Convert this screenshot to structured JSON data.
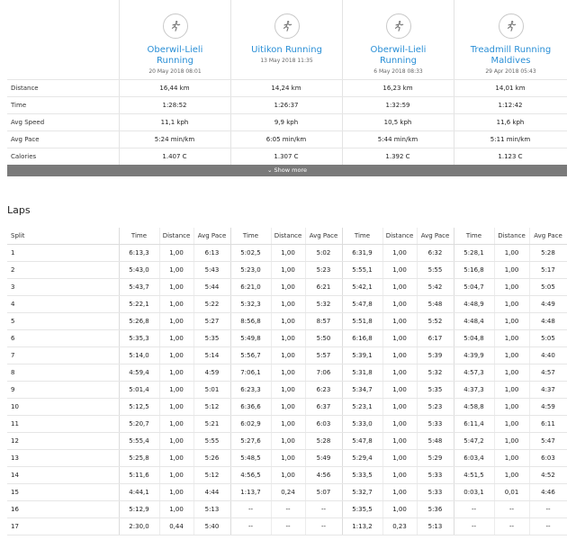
{
  "activities": [
    {
      "title": "Oberwil-Lieli Running",
      "date": "20 May 2018 08:01",
      "icon": "runner-icon"
    },
    {
      "title": "Uitikon Running",
      "date": "13 May 2018 11:35",
      "icon": "runner-icon"
    },
    {
      "title": "Oberwil-Lieli Running",
      "date": "6 May 2018 08:33",
      "icon": "runner-icon"
    },
    {
      "title": "Treadmill Running Maldives",
      "date": "29 Apr 2018 05:43",
      "icon": "runner-icon"
    }
  ],
  "stats": [
    {
      "label": "Distance",
      "values": [
        "16,44 km",
        "14,24 km",
        "16,23 km",
        "14,01 km"
      ]
    },
    {
      "label": "Time",
      "values": [
        "1:28:52",
        "1:26:37",
        "1:32:59",
        "1:12:42"
      ]
    },
    {
      "label": "Avg Speed",
      "values": [
        "11,1 kph",
        "9,9 kph",
        "10,5 kph",
        "11,6 kph"
      ]
    },
    {
      "label": "Avg Pace",
      "values": [
        "5:24 min/km",
        "6:05 min/km",
        "5:44 min/km",
        "5:11 min/km"
      ]
    },
    {
      "label": "Calories",
      "values": [
        "1.407 C",
        "1.307 C",
        "1.392 C",
        "1.123 C"
      ]
    }
  ],
  "show_more_label": "Show more",
  "laps": {
    "title": "Laps",
    "split_header": "Split",
    "col_headers": [
      "Time",
      "Distance",
      "Avg Pace"
    ],
    "rows": [
      {
        "split": "1",
        "cells": [
          [
            "6:13,3",
            "1,00",
            "6:13"
          ],
          [
            "5:02,5",
            "1,00",
            "5:02"
          ],
          [
            "6:31,9",
            "1,00",
            "6:32"
          ],
          [
            "5:28,1",
            "1,00",
            "5:28"
          ]
        ]
      },
      {
        "split": "2",
        "cells": [
          [
            "5:43,0",
            "1,00",
            "5:43"
          ],
          [
            "5:23,0",
            "1,00",
            "5:23"
          ],
          [
            "5:55,1",
            "1,00",
            "5:55"
          ],
          [
            "5:16,8",
            "1,00",
            "5:17"
          ]
        ]
      },
      {
        "split": "3",
        "cells": [
          [
            "5:43,7",
            "1,00",
            "5:44"
          ],
          [
            "6:21,0",
            "1,00",
            "6:21"
          ],
          [
            "5:42,1",
            "1,00",
            "5:42"
          ],
          [
            "5:04,7",
            "1,00",
            "5:05"
          ]
        ]
      },
      {
        "split": "4",
        "cells": [
          [
            "5:22,1",
            "1,00",
            "5:22"
          ],
          [
            "5:32,3",
            "1,00",
            "5:32"
          ],
          [
            "5:47,8",
            "1,00",
            "5:48"
          ],
          [
            "4:48,9",
            "1,00",
            "4:49"
          ]
        ]
      },
      {
        "split": "5",
        "cells": [
          [
            "5:26,8",
            "1,00",
            "5:27"
          ],
          [
            "8:56,8",
            "1,00",
            "8:57"
          ],
          [
            "5:51,8",
            "1,00",
            "5:52"
          ],
          [
            "4:48,4",
            "1,00",
            "4:48"
          ]
        ]
      },
      {
        "split": "6",
        "cells": [
          [
            "5:35,3",
            "1,00",
            "5:35"
          ],
          [
            "5:49,8",
            "1,00",
            "5:50"
          ],
          [
            "6:16,8",
            "1,00",
            "6:17"
          ],
          [
            "5:04,8",
            "1,00",
            "5:05"
          ]
        ]
      },
      {
        "split": "7",
        "cells": [
          [
            "5:14,0",
            "1,00",
            "5:14"
          ],
          [
            "5:56,7",
            "1,00",
            "5:57"
          ],
          [
            "5:39,1",
            "1,00",
            "5:39"
          ],
          [
            "4:39,9",
            "1,00",
            "4:40"
          ]
        ]
      },
      {
        "split": "8",
        "cells": [
          [
            "4:59,4",
            "1,00",
            "4:59"
          ],
          [
            "7:06,1",
            "1,00",
            "7:06"
          ],
          [
            "5:31,8",
            "1,00",
            "5:32"
          ],
          [
            "4:57,3",
            "1,00",
            "4:57"
          ]
        ]
      },
      {
        "split": "9",
        "cells": [
          [
            "5:01,4",
            "1,00",
            "5:01"
          ],
          [
            "6:23,3",
            "1,00",
            "6:23"
          ],
          [
            "5:34,7",
            "1,00",
            "5:35"
          ],
          [
            "4:37,3",
            "1,00",
            "4:37"
          ]
        ]
      },
      {
        "split": "10",
        "cells": [
          [
            "5:12,5",
            "1,00",
            "5:12"
          ],
          [
            "6:36,6",
            "1,00",
            "6:37"
          ],
          [
            "5:23,1",
            "1,00",
            "5:23"
          ],
          [
            "4:58,8",
            "1,00",
            "4:59"
          ]
        ]
      },
      {
        "split": "11",
        "cells": [
          [
            "5:20,7",
            "1,00",
            "5:21"
          ],
          [
            "6:02,9",
            "1,00",
            "6:03"
          ],
          [
            "5:33,0",
            "1,00",
            "5:33"
          ],
          [
            "6:11,4",
            "1,00",
            "6:11"
          ]
        ]
      },
      {
        "split": "12",
        "cells": [
          [
            "5:55,4",
            "1,00",
            "5:55"
          ],
          [
            "5:27,6",
            "1,00",
            "5:28"
          ],
          [
            "5:47,8",
            "1,00",
            "5:48"
          ],
          [
            "5:47,2",
            "1,00",
            "5:47"
          ]
        ]
      },
      {
        "split": "13",
        "cells": [
          [
            "5:25,8",
            "1,00",
            "5:26"
          ],
          [
            "5:48,5",
            "1,00",
            "5:49"
          ],
          [
            "5:29,4",
            "1,00",
            "5:29"
          ],
          [
            "6:03,4",
            "1,00",
            "6:03"
          ]
        ]
      },
      {
        "split": "14",
        "cells": [
          [
            "5:11,6",
            "1,00",
            "5:12"
          ],
          [
            "4:56,5",
            "1,00",
            "4:56"
          ],
          [
            "5:33,5",
            "1,00",
            "5:33"
          ],
          [
            "4:51,5",
            "1,00",
            "4:52"
          ]
        ]
      },
      {
        "split": "15",
        "cells": [
          [
            "4:44,1",
            "1,00",
            "4:44"
          ],
          [
            "1:13,7",
            "0,24",
            "5:07"
          ],
          [
            "5:32,7",
            "1,00",
            "5:33"
          ],
          [
            "0:03,1",
            "0,01",
            "4:46"
          ]
        ]
      },
      {
        "split": "16",
        "cells": [
          [
            "5:12,9",
            "1,00",
            "5:13"
          ],
          [
            "--",
            "--",
            "--"
          ],
          [
            "5:35,5",
            "1,00",
            "5:36"
          ],
          [
            "--",
            "--",
            "--"
          ]
        ]
      },
      {
        "split": "17",
        "cells": [
          [
            "2:30,0",
            "0,44",
            "5:40"
          ],
          [
            "--",
            "--",
            "--"
          ],
          [
            "1:13,2",
            "0,23",
            "5:13"
          ],
          [
            "--",
            "--",
            "--"
          ]
        ]
      }
    ]
  },
  "colors": {
    "link": "#2a8fd6",
    "bar": "#7a7a7a",
    "border": "#e3e3e3"
  }
}
